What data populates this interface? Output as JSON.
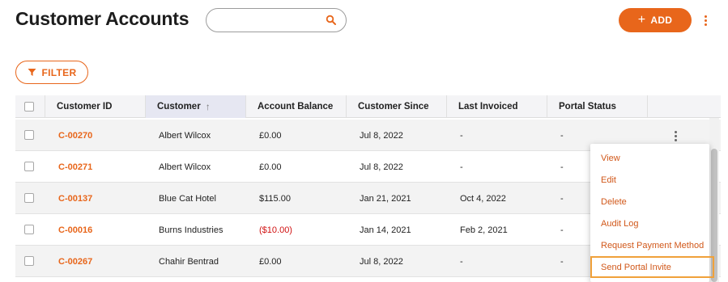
{
  "page": {
    "title": "Customer Accounts"
  },
  "search": {
    "value": "",
    "placeholder": ""
  },
  "toolbar": {
    "add_label": "ADD",
    "add_icon": "plus-icon",
    "more_icon": "kebab-icon",
    "filter_label": "FILTER",
    "filter_icon": "funnel-icon"
  },
  "colors": {
    "accent": "#e8661b",
    "negative": "#d01010",
    "row_alt": "#f3f3f3",
    "header_bg": "#f4f4f6",
    "sorted_header_bg": "#e6e7f2"
  },
  "table": {
    "columns": [
      "Customer ID",
      "Customer",
      "Account Balance",
      "Customer Since",
      "Last Invoiced",
      "Portal Status"
    ],
    "sort": {
      "column": "Customer",
      "direction": "ascending"
    },
    "rows": [
      {
        "id": "C-00270",
        "customer": "Albert Wilcox",
        "balance": "£0.00",
        "since": "Jul 8, 2022",
        "last_invoiced": "-",
        "portal": "-"
      },
      {
        "id": "C-00271",
        "customer": "Albert Wilcox",
        "balance": "£0.00",
        "since": "Jul 8, 2022",
        "last_invoiced": "-",
        "portal": "-"
      },
      {
        "id": "C-00137",
        "customer": "Blue Cat Hotel",
        "balance": "$115.00",
        "since": "Jan 21, 2021",
        "last_invoiced": "Oct 4, 2022",
        "portal": "-"
      },
      {
        "id": "C-00016",
        "customer": "Burns Industries",
        "balance": "($10.00)",
        "since": "Jan 14, 2021",
        "last_invoiced": "Feb 2, 2021",
        "portal": "-"
      },
      {
        "id": "C-00267",
        "customer": "Chahir Bentrad",
        "balance": "£0.00",
        "since": "Jul 8, 2022",
        "last_invoiced": "-",
        "portal": "-"
      }
    ]
  },
  "row_menu": {
    "items": [
      "View",
      "Edit",
      "Delete",
      "Audit Log",
      "Request Payment Method",
      "Send Portal Invite"
    ],
    "focused": "Send Portal Invite"
  }
}
